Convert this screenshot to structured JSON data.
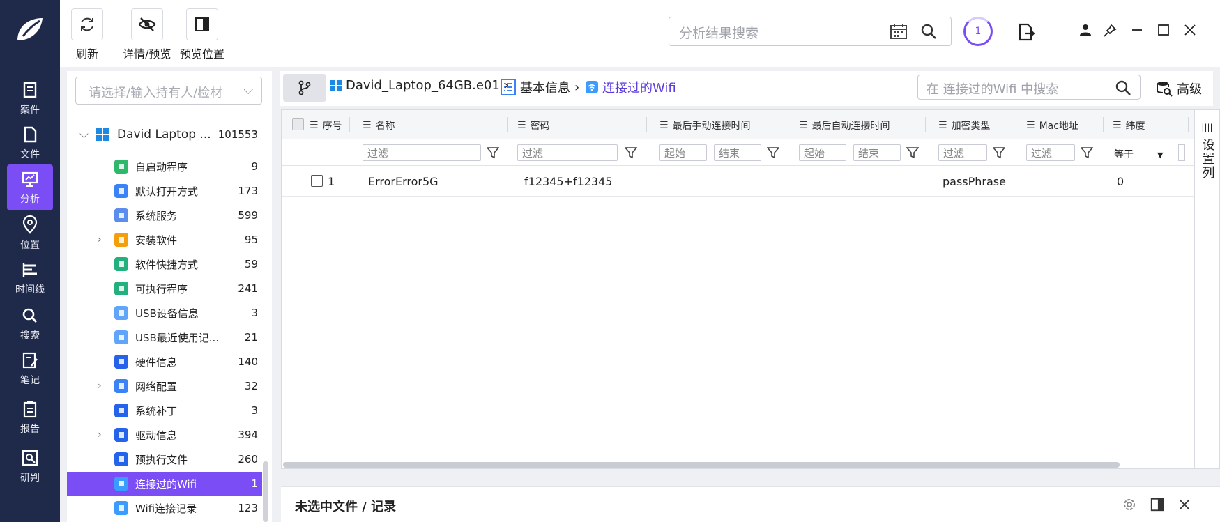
{
  "nav": {
    "items": [
      {
        "label": "案件",
        "icon": "case-icon"
      },
      {
        "label": "文件",
        "icon": "file-icon"
      },
      {
        "label": "分析",
        "icon": "analysis-icon"
      },
      {
        "label": "位置",
        "icon": "location-icon"
      },
      {
        "label": "时间线",
        "icon": "timeline-icon"
      },
      {
        "label": "搜索",
        "icon": "search-icon"
      },
      {
        "label": "笔记",
        "icon": "note-icon"
      },
      {
        "label": "报告",
        "icon": "report-icon"
      },
      {
        "label": "研判",
        "icon": "judge-icon"
      }
    ],
    "active_index": 2
  },
  "toolbar": {
    "refresh": "刷新",
    "detail_preview": "详情/预览",
    "preview_position": "预览位置",
    "search_placeholder": "分析结果搜索",
    "task_count": "1"
  },
  "left": {
    "search_placeholder": "请选择/输入持有人/检材",
    "root": {
      "label": "David Laptop ...",
      "count": "101553"
    },
    "items": [
      {
        "label": "自启动程序",
        "count": "9",
        "color": "#2fb86b",
        "expand": false
      },
      {
        "label": "默认打开方式",
        "count": "173",
        "color": "#3b82f6",
        "expand": false
      },
      {
        "label": "系统服务",
        "count": "599",
        "color": "#5b8def",
        "expand": false
      },
      {
        "label": "安装软件",
        "count": "95",
        "color": "#f59e0b",
        "expand": true
      },
      {
        "label": "软件快捷方式",
        "count": "59",
        "color": "#22b07d",
        "expand": false
      },
      {
        "label": "可执行程序",
        "count": "241",
        "color": "#22b07d",
        "expand": false
      },
      {
        "label": "USB设备信息",
        "count": "3",
        "color": "#60a5fa",
        "expand": false
      },
      {
        "label": "USB最近使用记...",
        "count": "21",
        "color": "#60a5fa",
        "expand": false
      },
      {
        "label": "硬件信息",
        "count": "140",
        "color": "#2563eb",
        "expand": false
      },
      {
        "label": "网络配置",
        "count": "32",
        "color": "#3b82f6",
        "expand": true
      },
      {
        "label": "系统补丁",
        "count": "3",
        "color": "#2563eb",
        "expand": false
      },
      {
        "label": "驱动信息",
        "count": "394",
        "color": "#2563eb",
        "expand": true
      },
      {
        "label": "预执行文件",
        "count": "260",
        "color": "#2563eb",
        "expand": false
      },
      {
        "label": "连接过的Wifi",
        "count": "1",
        "color": "#3b9cff",
        "expand": false,
        "selected": true
      },
      {
        "label": "Wifi连接记录",
        "count": "123",
        "color": "#3b9cff",
        "expand": false
      }
    ]
  },
  "crumbs": {
    "evidence": "David_Laptop_64GB.e01",
    "basic": "基本信息",
    "current": "连接过的Wifi",
    "search_placeholder": "在 连接过的Wifi 中搜索",
    "advanced": "高级"
  },
  "table": {
    "columns": [
      "序号",
      "名称",
      "密码",
      "最后手动连接时间",
      "最后自动连接时间",
      "加密类型",
      "Mac地址",
      "纬度"
    ],
    "filter": "过滤",
    "start": "起始",
    "end": "结束",
    "equals": "等于",
    "rows": [
      {
        "idx": "1",
        "name": "ErrorError5G",
        "password": "f12345+f12345",
        "manual": "",
        "auto": "",
        "enc": "passPhrase",
        "mac": "",
        "lat": "0"
      }
    ]
  },
  "set_columns": "设置列",
  "bottom_title": "未选中文件 / 记录"
}
